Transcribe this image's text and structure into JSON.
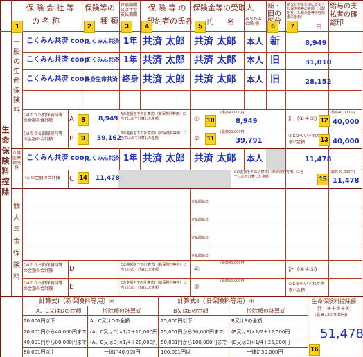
{
  "headers": {
    "company": "保 険 会 社 等",
    "company2": "の 名 称",
    "type": "保険等の",
    "type2": "種 類",
    "period": "保険期間又は年金支払期間",
    "insured": "保 険 等 の",
    "insured2": "契約者の氏名",
    "recipient": "保険金等の受取人",
    "recipient_name": "氏　　名",
    "relation": "あなたとの続 柄",
    "newold": "新・旧の区分",
    "amount": "あなたが本年中に支払った保険料等の金額（分配を受けた剰余金等の控除後の金額）",
    "confirm": "給与の支払者の確認印",
    "yen": "円"
  },
  "side": {
    "main": "生命保険料控除",
    "general": "一般の生命保険料",
    "medical": "介護医療保険料",
    "pension": "個人年金保険料"
  },
  "rows": [
    {
      "company": "こくみん共済 coop",
      "type": "こくみん共済",
      "period": "1年",
      "insured": "共済 太郎",
      "recipient": "共済 太郎",
      "relation": "本人",
      "newold": "新",
      "amount": "8,949"
    },
    {
      "company": "こくみん共済 coop",
      "type": "こくみん共済",
      "period": "1年",
      "insured": "共済 太郎",
      "recipient": "共済 太郎",
      "relation": "本人",
      "newold": "旧",
      "amount": "31,010"
    },
    {
      "company": "こくみん共済 coop",
      "type": "終身生命共済",
      "period": "終身",
      "insured": "共済 太郎",
      "recipient": "共済 太郎",
      "relation": "本人",
      "newold": "旧",
      "amount": "28,152"
    }
  ],
  "medical_row": {
    "company": "こくみん共済 coop",
    "type": "こくみん共済",
    "period": "1年",
    "insured": "共済 太郎",
    "recipient": "共済 太郎",
    "relation": "本人",
    "amount": "11,478"
  },
  "sub": {
    "A_label": "(a)のうち新保険料等の金額の合計額",
    "A": "A",
    "A_value": "8,949",
    "B_label": "(a)のうち旧保険料等の金額の合計額",
    "B": "B",
    "B_value": "59,162",
    "A_calc": "Aの金額を下の計算式Ⅰ（新保険料等用）に当てはめて計算した金額",
    "B_calc": "Bの金額を下の計算式Ⅱ（旧保険料等用）に当てはめて計算した金額",
    "max40": "(最高40,000円)",
    "max50": "(最高50,000円)",
    "max120": "(最高120,000円)",
    "calc1_value": "8,949",
    "calc2_value": "39,791",
    "sum_label": "計（①＋②）",
    "sum_value": "40,000",
    "either_label": "②と③のいずれか大きい金額",
    "either_value": "40,000",
    "C_label": "(a)の金額の合計額",
    "C": "C",
    "C_value": "11,478",
    "C_calc": "Cの金額を下の計算式Ⅰ（新保険料等用）に当てはめて計算した金額",
    "C_result": "11,478",
    "pay_start": "支払開始日",
    "D_label": "(a)のうち新保険料等の金額の合計額",
    "D": "D",
    "E_label": "(a)のうち旧保険料等の金額の合計額",
    "E": "E",
    "D_calc": "Dの金額を下の計算式Ⅰ（新保険料等用）に当てはめて計算した金額",
    "E_calc": "Eの金額を下の計算式Ⅱ（旧保険料等用）に当てはめて計算した金額",
    "sum2_label": "計（④＋⑤）",
    "either2_label": "⑤と⑥のいずれか大きい金額"
  },
  "formula": {
    "f1_title": "計算式Ⅰ（新保険料等用）※",
    "f2_title": "計算式Ⅱ（旧保険料等用）※",
    "f1_h1": "A、C又はDの金額",
    "f1_h2": "控除額の計算式",
    "f2_h1": "B又はEの金額",
    "f2_h2": "控除額の計算式",
    "f1_rows": [
      [
        "20,000円以下",
        "A、C又はDの全額"
      ],
      [
        "20,001円から40,000円まで",
        "(A、C又はD)×1/2＋10,000円"
      ],
      [
        "40,001円から80,000円まで",
        "(A、C又はD)×1/4＋20,000円"
      ],
      [
        "80,001円以上",
        "一律に40,000円"
      ]
    ],
    "f2_rows": [
      [
        "25,000円以下",
        "B又はEの全額"
      ],
      [
        "25,001円から50,000円まで",
        "(B又はE)×1/2＋12,500円"
      ],
      [
        "50,001円から100,000円まで",
        "(B又はE)×1/4＋25,000円"
      ],
      [
        "100,001円以上",
        "一律に50,000円"
      ]
    ],
    "total_title": "生命保険料控除額",
    "total_formula": "計（④＋⑦＋⑧）",
    "total_value": "51,478"
  },
  "badges": [
    "1",
    "2",
    "3",
    "4",
    "5",
    "6",
    "7",
    "8",
    "9",
    "10",
    "11",
    "12",
    "13",
    "14",
    "15",
    "16"
  ]
}
